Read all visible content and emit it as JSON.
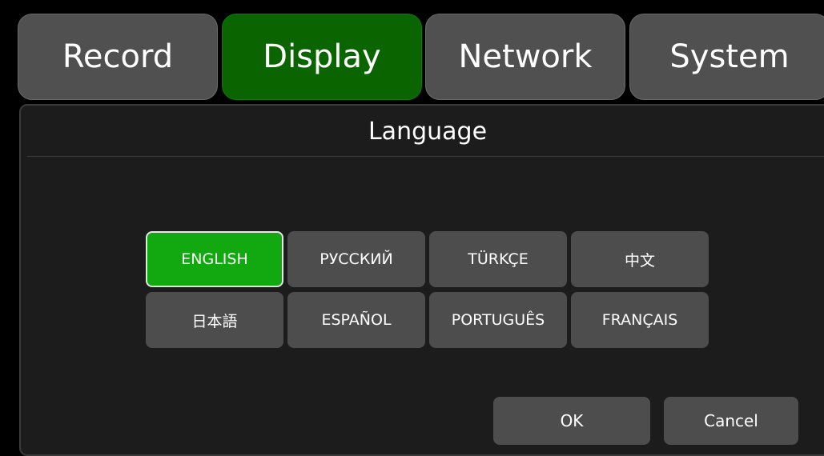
{
  "tabs": [
    {
      "label": "Record",
      "active": false
    },
    {
      "label": "Display",
      "active": true
    },
    {
      "label": "Network",
      "active": false
    },
    {
      "label": "System",
      "active": false
    }
  ],
  "panel": {
    "title": "Language"
  },
  "languages": [
    {
      "label": "ENGLISH",
      "selected": true
    },
    {
      "label": "РУССКИЙ",
      "selected": false
    },
    {
      "label": "TÜRKÇE",
      "selected": false
    },
    {
      "label": "中文",
      "selected": false
    },
    {
      "label": "日本語",
      "selected": false
    },
    {
      "label": "ESPAÑOL",
      "selected": false
    },
    {
      "label": "PORTUGUÊS",
      "selected": false
    },
    {
      "label": "FRANÇAIS",
      "selected": false
    }
  ],
  "actions": {
    "ok_label": "OK",
    "cancel_label": "Cancel"
  },
  "colors": {
    "active_tab": "#0a6400",
    "selected_language": "#12a80f",
    "button": "#4d4d4d",
    "panel_background": "#1c1c1c"
  }
}
